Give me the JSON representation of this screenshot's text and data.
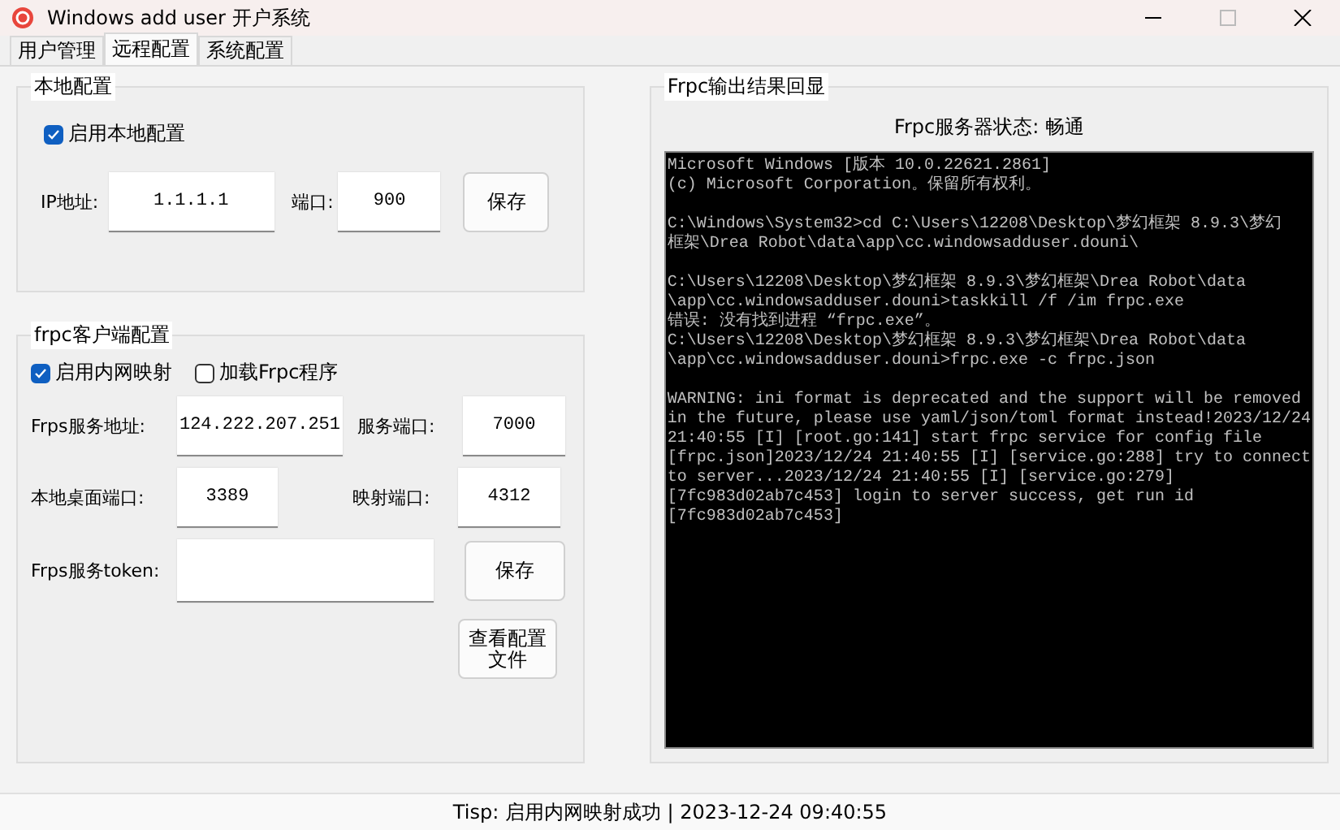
{
  "window": {
    "title": "Windows add user 开户系统"
  },
  "tabs": [
    {
      "label": "用户管理",
      "selected": false
    },
    {
      "label": "远程配置",
      "selected": true
    },
    {
      "label": "系统配置",
      "selected": false
    }
  ],
  "local_config": {
    "title": "本地配置",
    "enable": {
      "label": "启用本地配置",
      "checked": true
    },
    "ip": {
      "label": "IP地址:",
      "value": "1.1.1.1"
    },
    "port": {
      "label": "端口:",
      "value": "900"
    },
    "save_button": "保存"
  },
  "frpc_config": {
    "title": "frpc客户端配置",
    "options": [
      {
        "label": "启用内网映射",
        "checked": true
      },
      {
        "label": "加载Frpc程序",
        "checked": false
      }
    ],
    "rows": [
      [
        {
          "label": "Frps服务地址:",
          "value": "124.222.207.251"
        },
        {
          "label": "服务端口:",
          "value": "7000"
        }
      ],
      [
        {
          "label": "本地桌面端口:",
          "value": "3389"
        },
        {
          "label": "映射端口:",
          "value": "4312"
        }
      ],
      [
        {
          "label": "Frps服务token:"
        }
      ]
    ],
    "save_button": "保存",
    "view_button": "查看配置文件"
  },
  "output": {
    "title": "Frpc输出结果回显",
    "status": "Frpc服务器状态: 畅通",
    "console_blocks": [
      [
        "Microsoft Windows [版本 10.0.22621.2861]",
        "(c) Microsoft Corporation。保留所有权利。"
      ],
      [
        "C:\\Windows\\System32>cd C:\\Users\\12208\\Desktop\\梦幻框架 8.9.3\\梦幻",
        "框架\\Drea Robot\\data\\app\\cc.windowsadduser.douni\\"
      ],
      [
        "C:\\Users\\12208\\Desktop\\梦幻框架 8.9.3\\梦幻框架\\Drea Robot\\data",
        "\\app\\cc.windowsadduser.douni>taskkill /f /im frpc.exe",
        "错误: 没有找到进程 “frpc.exe”。",
        "C:\\Users\\12208\\Desktop\\梦幻框架 8.9.3\\梦幻框架\\Drea Robot\\data",
        "\\app\\cc.windowsadduser.douni>frpc.exe -c frpc.json"
      ],
      [
        "WARNING: ini format is deprecated and the support will be removed",
        "in the future, please use yaml/json/toml format instead!2023/12/24",
        "21:40:55 [I] [root.go:141] start frpc service for config file",
        "[frpc.json]2023/12/24 21:40:55 [I] [service.go:288] try to connect",
        "to server...2023/12/24 21:40:55 [I] [service.go:279]",
        "[7fc983d02ab7c453] login to server success, get run id",
        "[7fc983d02ab7c453]"
      ]
    ]
  },
  "status_bar": "Tisp: 启用内网映射成功 | 2023-12-24 09:40:55"
}
